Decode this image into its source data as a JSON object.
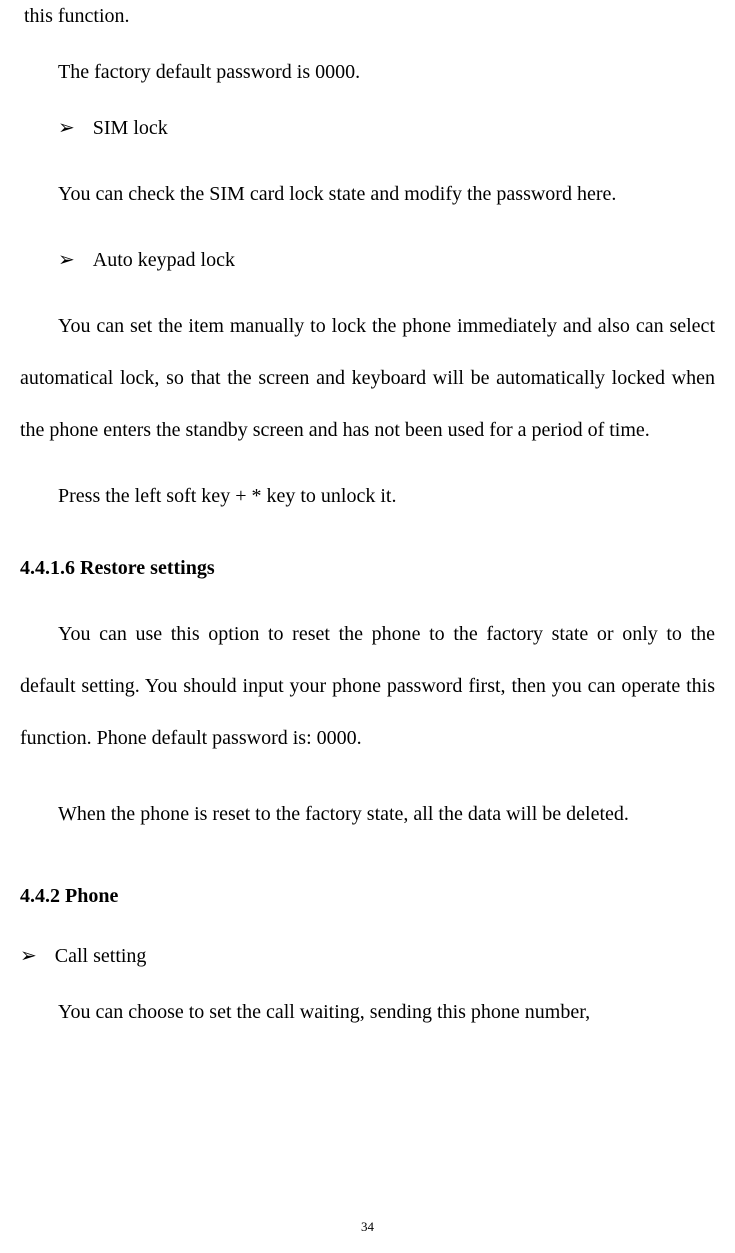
{
  "para_fragment_top": "this function.",
  "para_factory_default": "The factory default password is 0000.",
  "bullet_sim_lock": "SIM lock",
  "para_sim_lock": "You can check the SIM card lock state and modify the password here.",
  "bullet_auto_keypad": "Auto keypad lock",
  "para_auto_keypad": "You can set the item manually to lock the phone immediately and also can select automatical lock, so that the screen and keyboard will be automatically locked when the phone enters the standby screen and has not been used for a period of time.",
  "para_unlock": "Press the left soft key + * key to unlock it.",
  "heading_restore": "4.4.1.6 Restore settings",
  "para_restore1": "You can use this option to reset the phone to the factory state or only to the default setting. You should input your phone password first, then you can operate this function. Phone default password is: 0000.",
  "para_restore2": "When the phone is reset to the factory state, all the data will be deleted.",
  "heading_phone": "4.4.2 Phone",
  "bullet_call_setting": "Call setting",
  "para_call_setting": "You can choose to set the call waiting, sending this phone number,",
  "page_number": "34",
  "arrow": "➢"
}
